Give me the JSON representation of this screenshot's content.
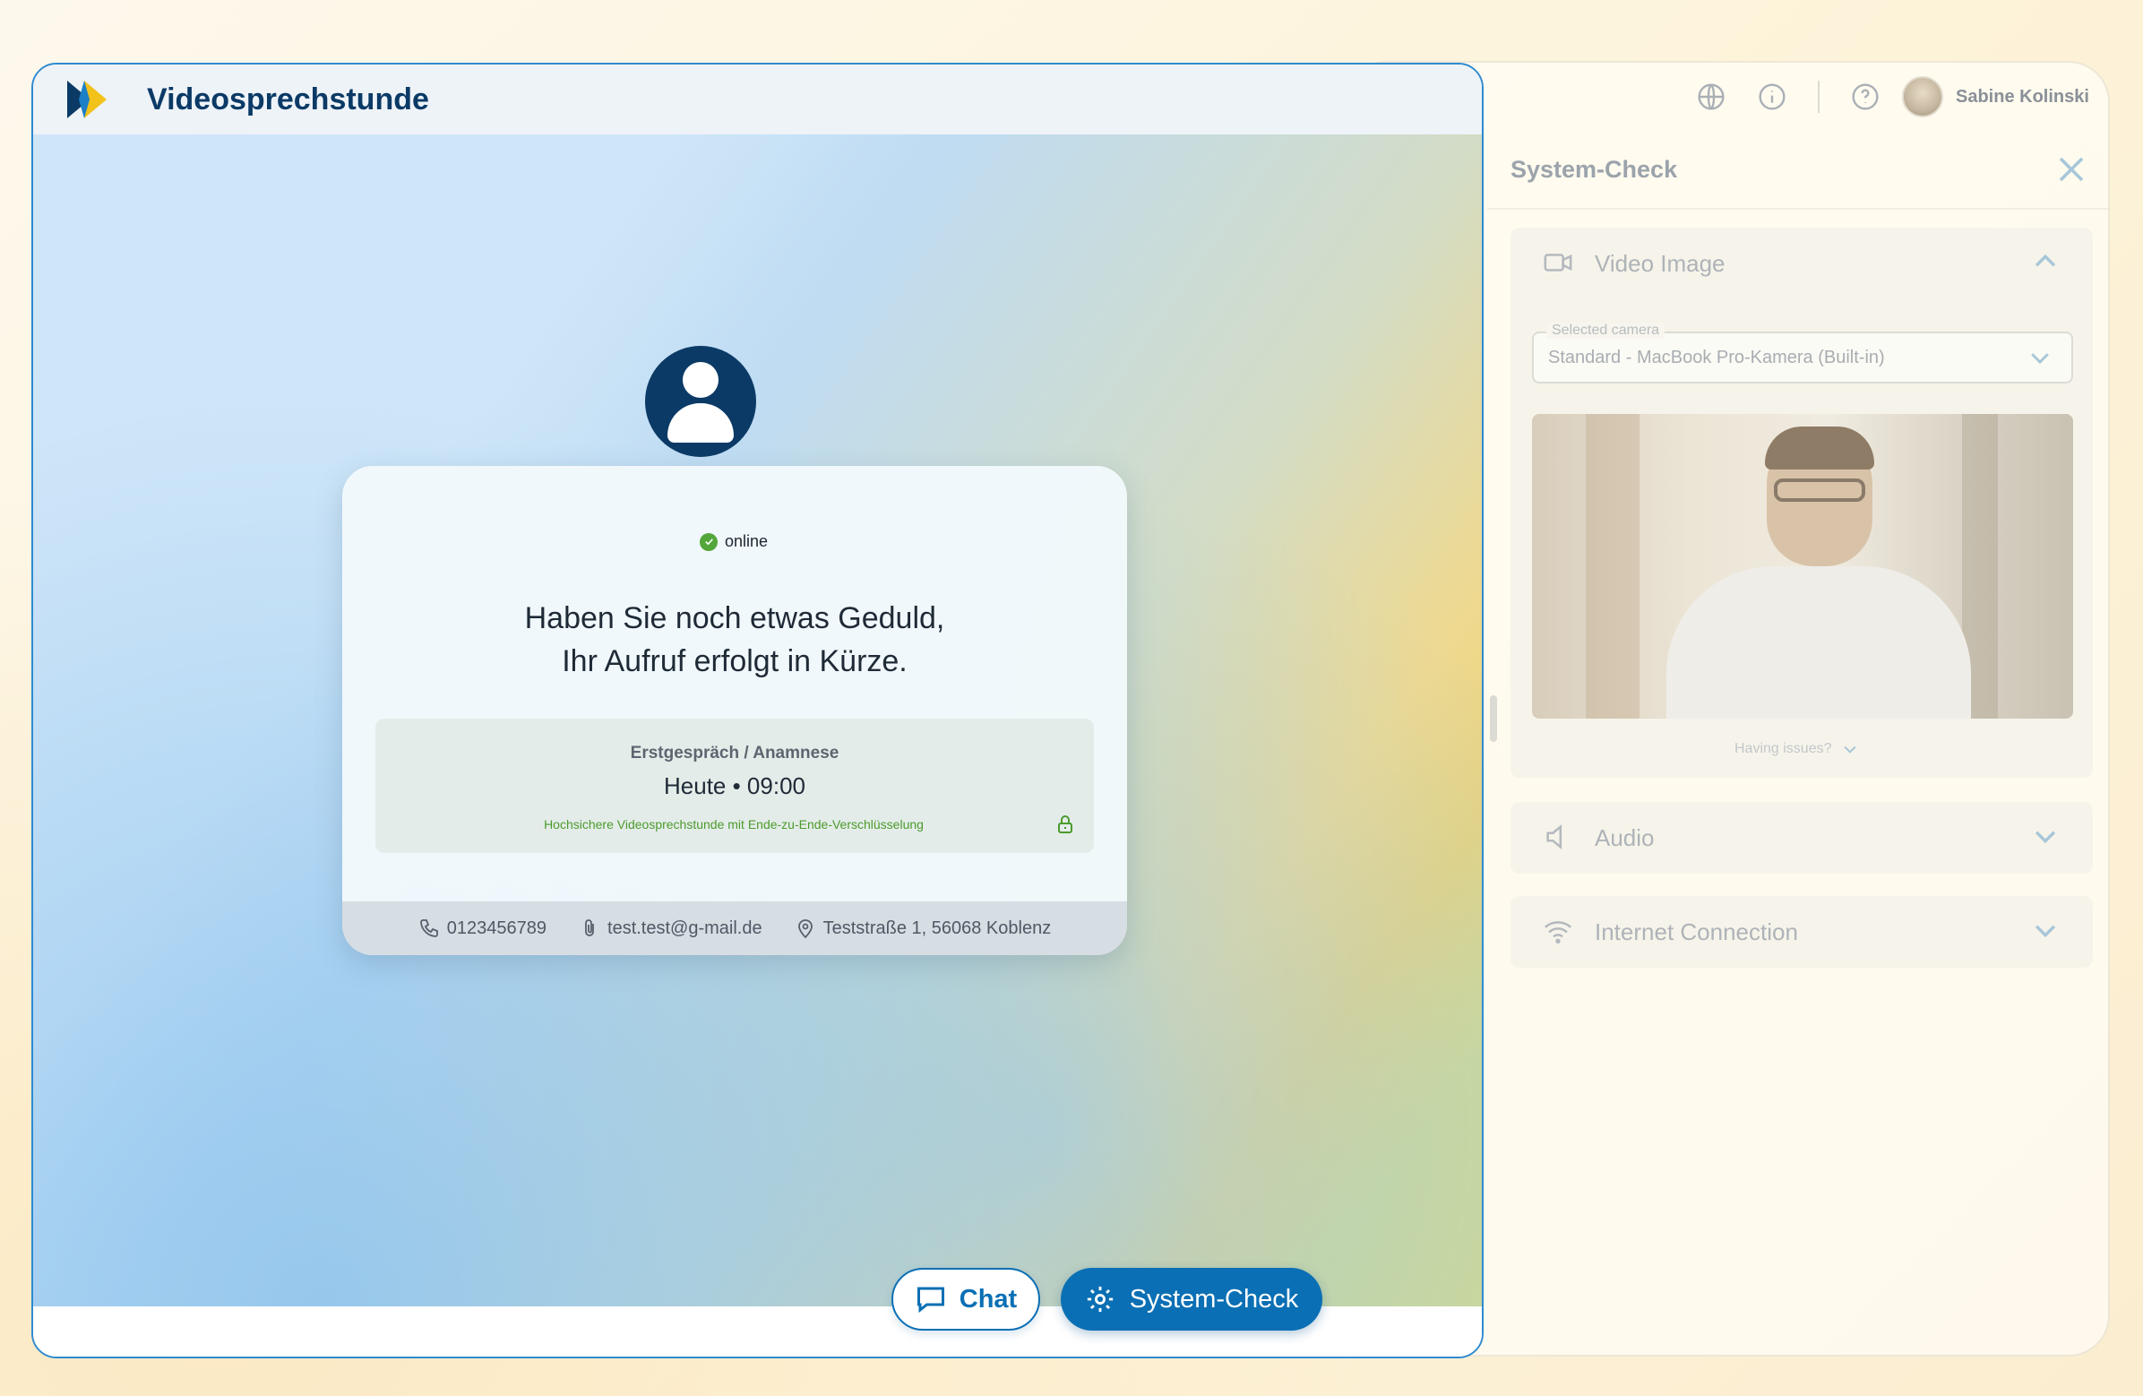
{
  "app": {
    "title": "Videosprechstunde",
    "colors": {
      "brand_dark": "#0b3a66",
      "accent": "#0a6fb4",
      "online": "#53a639"
    }
  },
  "header": {
    "icons": [
      "globe-icon",
      "info-icon",
      "help-icon"
    ],
    "user_name": "Sabine Kolinski"
  },
  "system_check": {
    "title": "System-Check",
    "video": {
      "label": "Video Image",
      "camera_label": "Selected camera",
      "camera_value": "Standard - MacBook Pro-Kamera (Built-in)",
      "issues_label": "Having issues?"
    },
    "audio_label": "Audio",
    "internet_label": "Internet Connection"
  },
  "waiting": {
    "status": "online",
    "message_line1": "Haben Sie noch etwas Geduld,",
    "message_line2": "Ihr Aufruf erfolgt in Kürze.",
    "appointment_type": "Erstgespräch / Anamnese",
    "appointment_time": "Heute • 09:00",
    "secure_note": "Hochsichere Videosprechstunde mit Ende-zu-Ende-Verschlüsselung",
    "phone": "0123456789",
    "email": "test.test@g-mail.de",
    "address": "Teststraße 1, 56068 Koblenz"
  },
  "actions": {
    "chat_label": "Chat",
    "system_check_label": "System-Check"
  }
}
